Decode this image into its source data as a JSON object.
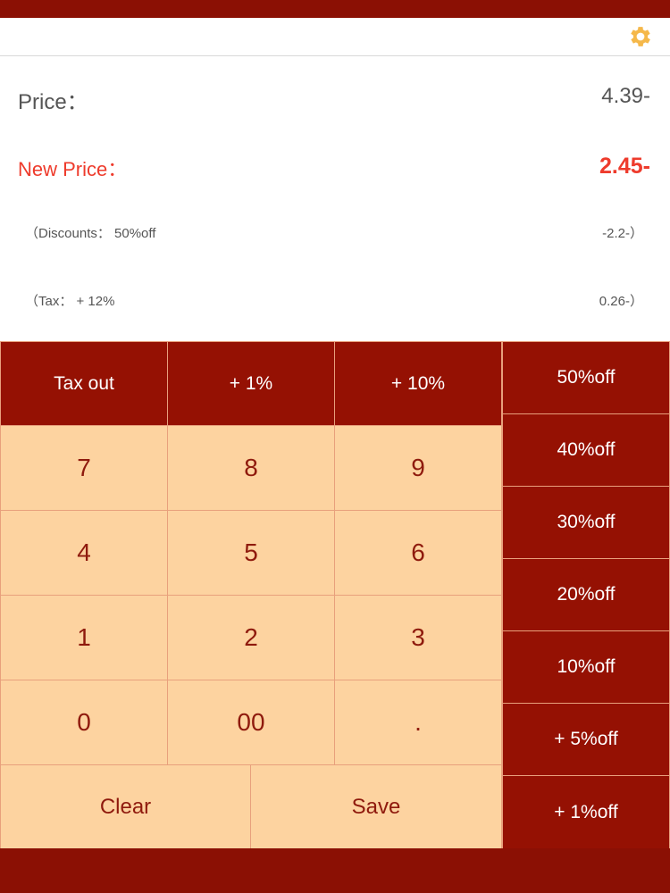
{
  "header": {
    "settings_icon": "gear-icon",
    "accent_color": "#f5b84a"
  },
  "display": {
    "price_label": "Price：",
    "price_value": "4.39-",
    "new_price_label": "New Price：",
    "new_price_value": "2.45-",
    "discount_label": "（Discounts： 50%off",
    "discount_value": "-2.2-）",
    "tax_label": "（Tax： + 12%",
    "tax_value": "0.26-）"
  },
  "keypad": {
    "tax_out": "Tax out",
    "plus1": "+ 1%",
    "plus10": "+ 10%",
    "digits": [
      "7",
      "8",
      "9",
      "4",
      "5",
      "6",
      "1",
      "2",
      "3",
      "0",
      "00",
      "."
    ],
    "clear": "Clear",
    "save": "Save"
  },
  "discount_buttons": [
    "50%off",
    "40%off",
    "30%off",
    "20%off",
    "10%off",
    "+ 5%off",
    "+ 1%off"
  ],
  "colors": {
    "primary": "#951103",
    "key_light": "#fdd3a0",
    "new_price": "#ee3b2c"
  }
}
